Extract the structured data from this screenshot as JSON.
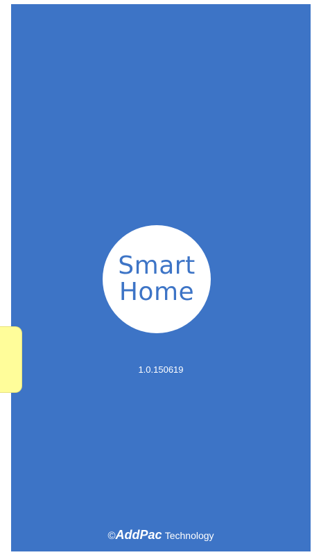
{
  "splash": {
    "logo_line1": "Smart",
    "logo_line2": "Home",
    "version": "1.0.150619",
    "copyright_symbol": "©",
    "copyright_brand": "AddPac",
    "copyright_suffix": "Technology"
  },
  "colors": {
    "background": "#3d74c6",
    "logo_circle": "#ffffff",
    "logo_text": "#3d74c6",
    "side_tab": "#fffd9a"
  }
}
